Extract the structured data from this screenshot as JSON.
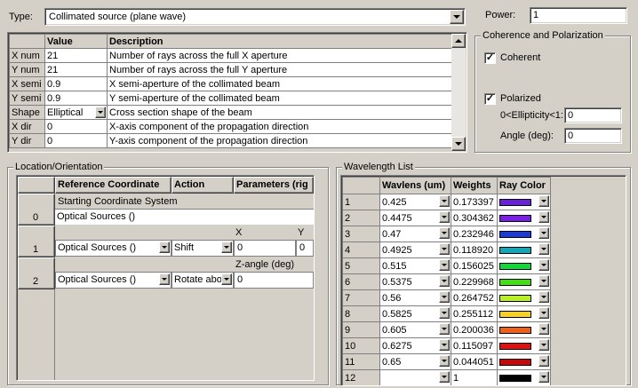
{
  "type_label": "Type:",
  "type_value": "Collimated source (plane wave)",
  "power_label": "Power:",
  "power_value": "1",
  "param_table": {
    "headers": [
      "",
      "Value",
      "Description"
    ],
    "rows": [
      {
        "name": "X num",
        "value": "21",
        "desc": "Number of rays across the full X aperture"
      },
      {
        "name": "Y num",
        "value": "21",
        "desc": "Number of rays across the full Y aperture"
      },
      {
        "name": "X semi",
        "value": "0.9",
        "desc": "X semi-aperture of the collimated beam"
      },
      {
        "name": "Y semi",
        "value": "0.9",
        "desc": "Y semi-aperture of the collimated beam"
      },
      {
        "name": "Shape",
        "value": "Elliptical",
        "desc": "Cross section shape of the beam"
      },
      {
        "name": "X dir",
        "value": "0",
        "desc": "X-axis component of the propagation direction"
      },
      {
        "name": "Y dir",
        "value": "0",
        "desc": "Y-axis component of the propagation direction"
      }
    ]
  },
  "coherence": {
    "title": "Coherence and Polarization",
    "coherent_label": "Coherent",
    "polarized_label": "Polarized",
    "ellipticity_label": "0<Ellipticity<1:",
    "ellipticity_value": "0",
    "angle_label": "Angle (deg):",
    "angle_value": "0"
  },
  "location": {
    "title": "Location/Orientation",
    "headers": [
      "Reference Coordinate",
      "Action",
      "Parameters (rig"
    ],
    "rows": [
      {
        "index": "0",
        "line1": "Starting Coordinate System",
        "coord": "Optical Sources   ()"
      },
      {
        "index": "1",
        "sub1": "X",
        "sub2": "Y",
        "coord": "Optical Sources   ()",
        "action": "Shift",
        "p1": "0",
        "p2": "0"
      },
      {
        "index": "2",
        "sub1": "Z-angle (deg)",
        "coord": "Optical Sources   ()",
        "action": "Rotate abo",
        "p1": "0"
      }
    ]
  },
  "wavelength": {
    "title": "Wavelength List",
    "headers": [
      "",
      "Wavlens (um)",
      "Weights",
      "Ray Color"
    ],
    "rows": [
      {
        "n": "1",
        "wl": "0.425",
        "w": "0.173397",
        "color": "#6a20d8"
      },
      {
        "n": "2",
        "wl": "0.4475",
        "w": "0.304362",
        "color": "#7a1ee8"
      },
      {
        "n": "3",
        "wl": "0.47",
        "w": "0.232946",
        "color": "#1a3ad8"
      },
      {
        "n": "4",
        "wl": "0.4925",
        "w": "0.118920",
        "color": "#10a8b8"
      },
      {
        "n": "5",
        "wl": "0.515",
        "w": "0.156025",
        "color": "#10d838"
      },
      {
        "n": "6",
        "wl": "0.5375",
        "w": "0.229968",
        "color": "#40e010"
      },
      {
        "n": "7",
        "wl": "0.56",
        "w": "0.264752",
        "color": "#b8f020"
      },
      {
        "n": "8",
        "wl": "0.5825",
        "w": "0.255112",
        "color": "#f8d020"
      },
      {
        "n": "9",
        "wl": "0.605",
        "w": "0.200036",
        "color": "#f06018"
      },
      {
        "n": "10",
        "wl": "0.6275",
        "w": "0.115097",
        "color": "#e01010"
      },
      {
        "n": "11",
        "wl": "0.65",
        "w": "0.044051",
        "color": "#c80808"
      },
      {
        "n": "12",
        "wl": "",
        "w": "1",
        "color": "#000000"
      }
    ]
  }
}
